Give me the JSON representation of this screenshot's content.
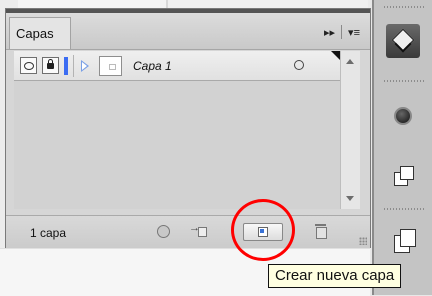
{
  "panel": {
    "tab_label": "Capas",
    "menu_collapse_symbol": "▸▸",
    "menu_options_symbol": "▾≡"
  },
  "layers": [
    {
      "name": "Capa 1",
      "color": "#3b6cf2",
      "visible": true,
      "locked": true
    }
  ],
  "footer": {
    "count_label": "1 capa"
  },
  "tooltip": {
    "text": "Crear nueva capa"
  },
  "icons": {
    "visibility": "eye-icon",
    "lock": "lock-icon",
    "expand": "expand-triangle-icon",
    "target": "target-circle-icon",
    "locate": "locate-object-icon",
    "move": "move-selection-icon",
    "new_layer": "new-layer-icon",
    "delete": "trash-icon",
    "dock_layers": "layers-panel-icon",
    "dock_appearance": "appearance-icon",
    "dock_transform": "transform-icon",
    "dock_pages": "pages-icon"
  },
  "highlight_color": "#ff0000"
}
